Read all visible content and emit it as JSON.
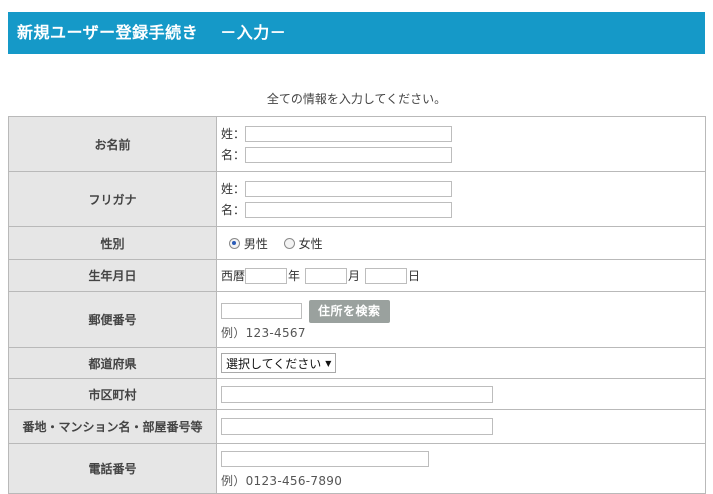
{
  "header": {
    "title": "新規ユーザー登録手続き",
    "subtitle": "－入力－"
  },
  "intro": "全ての情報を入力してください。",
  "fields": {
    "name": {
      "label": "お名前",
      "sei": "姓：",
      "mei": "名："
    },
    "furigana": {
      "label": "フリガナ",
      "sei": "姓：",
      "mei": "名："
    },
    "gender": {
      "label": "性別",
      "options": [
        "男性",
        "女性"
      ],
      "selected": "男性"
    },
    "birth": {
      "label": "生年月日",
      "era": "西暦",
      "year": "年",
      "month": "月",
      "day": "日"
    },
    "postal": {
      "label": "郵便番号",
      "button": "住所を検索",
      "example": "例）123-4567"
    },
    "prefecture": {
      "label": "都道府県",
      "selected": "選択してください"
    },
    "city": {
      "label": "市区町村"
    },
    "address": {
      "label": "番地・マンション名・部屋番号等"
    },
    "phone": {
      "label": "電話番号",
      "example": "例）0123-456-7890"
    }
  }
}
